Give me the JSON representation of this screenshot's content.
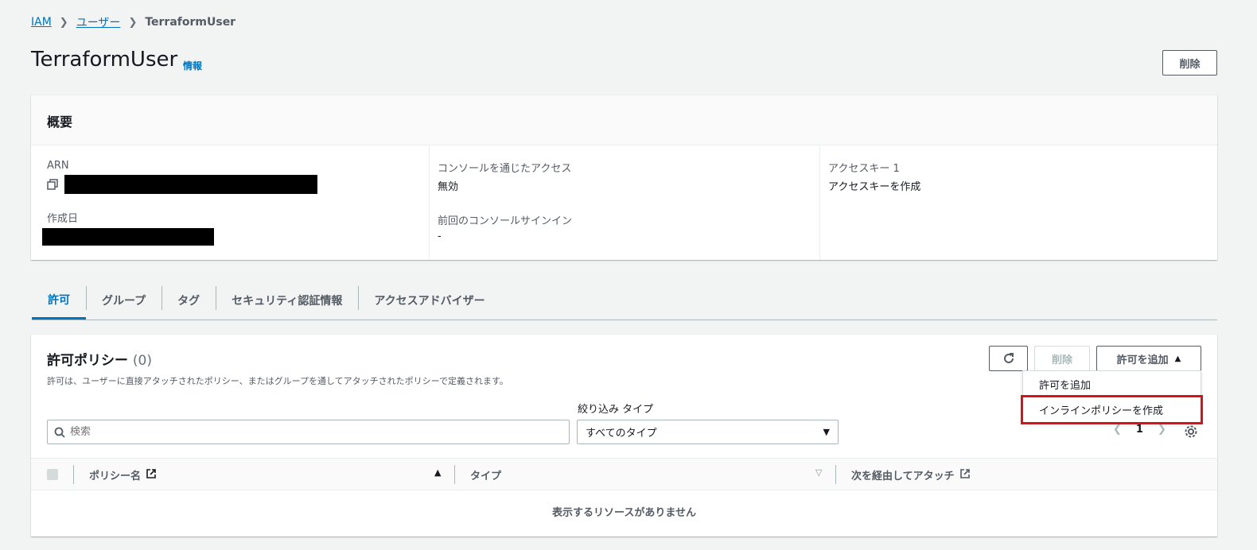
{
  "breadcrumb": {
    "iam": "IAM",
    "users": "ユーザー",
    "current": "TerraformUser"
  },
  "page": {
    "title": "TerraformUser",
    "info": "情報",
    "delete": "削除"
  },
  "summary": {
    "header": "概要",
    "arn_label": "ARN",
    "created_label": "作成日",
    "console_access_label": "コンソールを通じたアクセス",
    "console_access_value": "無効",
    "last_signin_label": "前回のコンソールサインイン",
    "last_signin_value": "-",
    "access_key_label": "アクセスキー 1",
    "create_access_key": "アクセスキーを作成"
  },
  "tabs": [
    {
      "label": "許可",
      "active": true
    },
    {
      "label": "グループ"
    },
    {
      "label": "タグ"
    },
    {
      "label": "セキュリティ認証情報"
    },
    {
      "label": "アクセスアドバイザー"
    }
  ],
  "permissions": {
    "title": "許可ポリシー",
    "count": "(0)",
    "description": "許可は、ユーザーに直接アタッチされたポリシー、またはグループを通してアタッチされたポリシーで定義されます。",
    "delete": "削除",
    "add": "許可を追加",
    "dropdown": [
      "許可を追加",
      "インラインポリシーを作成"
    ],
    "filter_label": "絞り込み タイプ",
    "search_placeholder": "検索",
    "filter_value": "すべてのタイプ",
    "page": "1",
    "columns": [
      "ポリシー名",
      "タイプ",
      "次を経由してアタッチ"
    ],
    "empty": "表示するリソースがありません"
  }
}
